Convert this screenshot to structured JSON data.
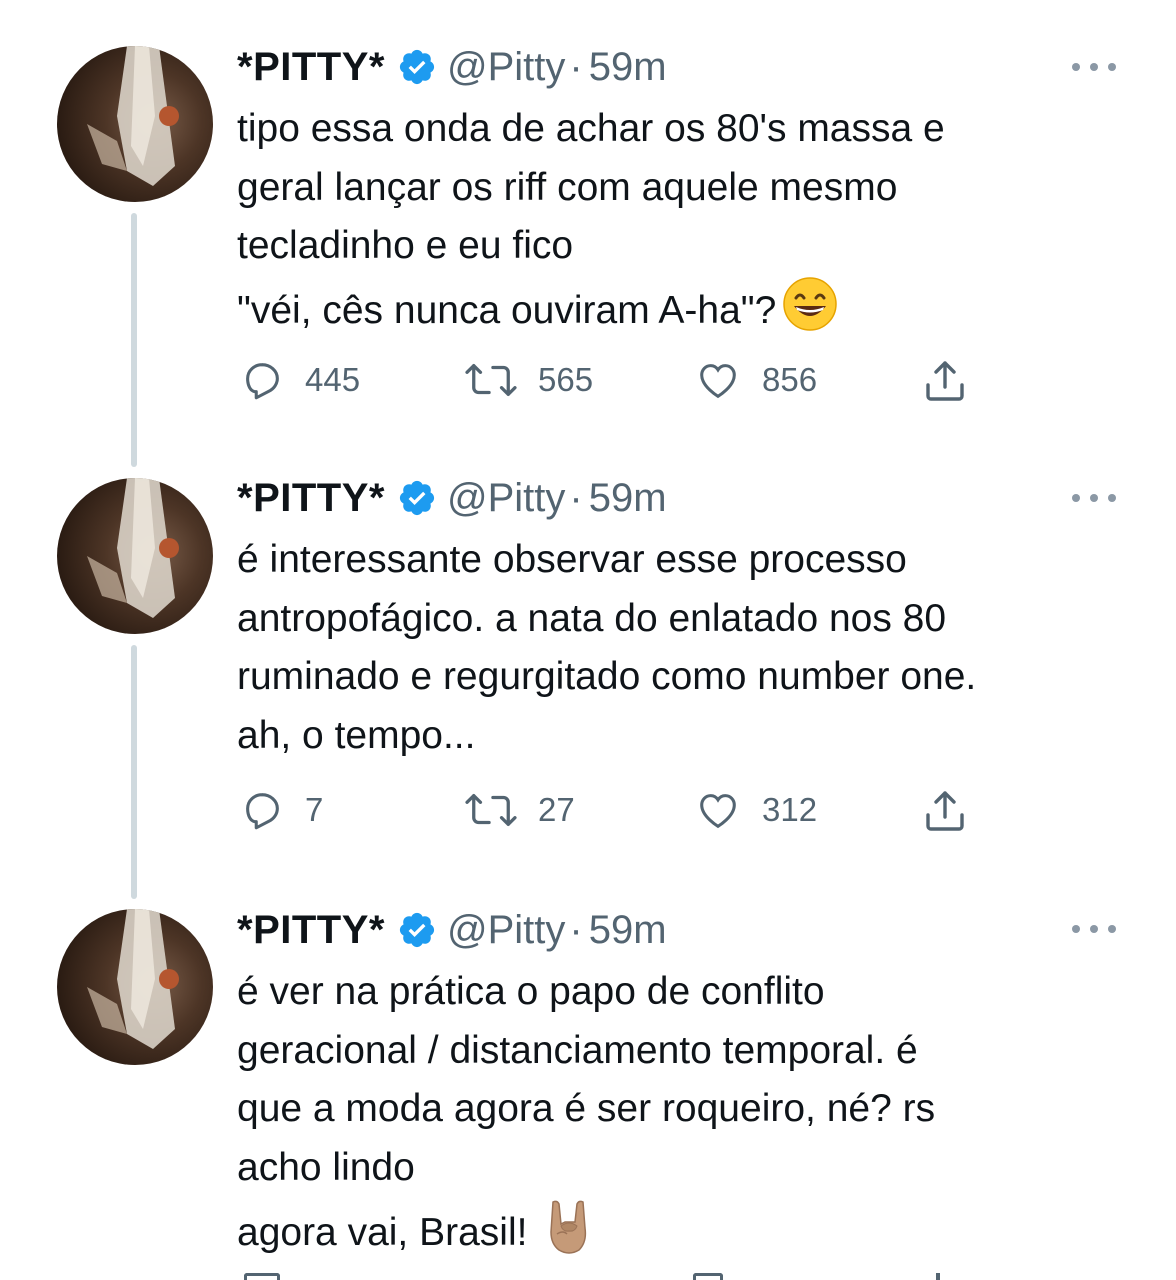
{
  "tweets": [
    {
      "name": "*PITTY*",
      "handle": "@Pitty",
      "separator": "·",
      "time": "59m",
      "lines": [
        "tipo essa onda de achar os 80's massa e",
        "geral lançar os riff com aquele mesmo",
        "tecladinho e eu fico",
        "\"véi, cês nunca ouviram A-ha\"?"
      ],
      "emoji": "grinning-face-with-smiling-eyes",
      "replies": "445",
      "retweets": "565",
      "likes": "856"
    },
    {
      "name": "*PITTY*",
      "handle": "@Pitty",
      "separator": "·",
      "time": "59m",
      "lines": [
        "é interessante observar esse processo",
        "antropofágico. a nata do enlatado nos 80",
        "ruminado e regurgitado como number one.",
        "ah, o tempo..."
      ],
      "replies": "7",
      "retweets": "27",
      "likes": "312"
    },
    {
      "name": "*PITTY*",
      "handle": "@Pitty",
      "separator": "·",
      "time": "59m",
      "lines": [
        "é ver na prática o papo de conflito",
        "geracional / distanciamento temporal. é",
        "que a moda agora é ser roqueiro, né? rs",
        "acho lindo",
        "agora vai, Brasil!"
      ],
      "emoji": "sign-of-the-horns-medium-skin-tone"
    }
  ],
  "colors": {
    "text": "#0f1419",
    "secondary": "#536471",
    "verified": "#1d9bf0",
    "thread_line": "#cfd9de"
  },
  "icons": [
    "reply-icon",
    "retweet-icon",
    "like-icon",
    "share-icon",
    "verified-badge-icon",
    "more-options-icon"
  ]
}
